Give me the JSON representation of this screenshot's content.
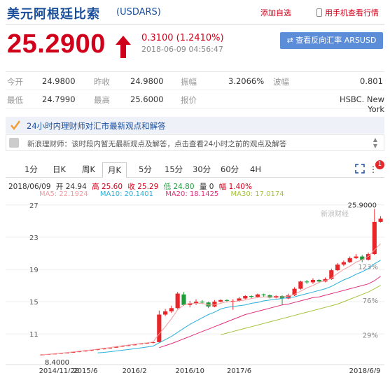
{
  "header": {
    "title": "美元阿根廷比索",
    "code": "(USDARS)",
    "add_favorite": "添加自选",
    "phone_view": "用手机查看行情"
  },
  "quote": {
    "price": "25.2900",
    "change": "0.3100 (1.2410%)",
    "timestamp": "2018-06-09 04:56:47",
    "reverse_button": "查看反向汇率 ARSUSD"
  },
  "stats": {
    "open_label": "今开",
    "open": "24.9800",
    "prev_close_label": "昨收",
    "prev_close": "24.9800",
    "amplitude_label": "振幅",
    "amplitude": "3.2066%",
    "volatility_label": "波幅",
    "volatility": "0.801",
    "low_label": "最低",
    "low": "24.7990",
    "high_label": "最高",
    "high": "25.6000",
    "quote_label": "报价",
    "quote_source": "HSBC. New York"
  },
  "expert": {
    "title": "24小时内理财师对汇市最新观点和解答",
    "message": "新浪理财师：该时段内暂无最新观点及解答，点击查看24小时之前的观点及解答"
  },
  "tabs": [
    "1分",
    "日K",
    "周K",
    "月K",
    "5分",
    "15分",
    "30分",
    "60分",
    "4H"
  ],
  "active_tab": "月K",
  "badge_count": "1",
  "ohlc": {
    "date": "2018/06/09",
    "open": "开 24.94",
    "high": "高 25.60",
    "close": "收 25.29",
    "low": "低 24.80",
    "volume": "量 0",
    "range": "幅 1.40%"
  },
  "ma": {
    "ma5": "MA5: 22.1924",
    "ma10": "MA10: 20.1401",
    "ma20": "MA20: 18.1425",
    "ma30": "MA30: 17.0174"
  },
  "colors": {
    "up": "#e8262a",
    "down": "#1e9b3a",
    "ma5": "#f29c9f",
    "ma10": "#2ab0d8",
    "ma20": "#e0307a",
    "ma30": "#a5c23a"
  },
  "chart_data": {
    "type": "candlestick",
    "yticks": [
      "27",
      "23",
      "19",
      "15",
      "11"
    ],
    "ylim": [
      7.2,
      27.5
    ],
    "pct_labels": [
      "123%",
      "76%",
      "29%"
    ],
    "xticks": [
      "2014/11/28",
      "2015/6",
      "2016/2",
      "2016/10",
      "2017/6",
      "2018/6/9"
    ],
    "min_label": "8.4000",
    "max_label": "25.9000",
    "watermark": "新浪财经",
    "candles": [
      [
        8.4,
        8.45,
        8.38,
        8.48
      ],
      [
        8.45,
        8.5,
        8.42,
        8.53
      ],
      [
        8.5,
        8.56,
        8.48,
        8.6
      ],
      [
        8.56,
        8.62,
        8.54,
        8.66
      ],
      [
        8.62,
        8.68,
        8.6,
        8.72
      ],
      [
        8.68,
        8.76,
        8.66,
        8.8
      ],
      [
        8.76,
        8.84,
        8.74,
        8.88
      ],
      [
        8.84,
        8.92,
        8.82,
        8.96
      ],
      [
        8.92,
        9.01,
        8.9,
        9.05
      ],
      [
        9.01,
        9.1,
        8.99,
        9.14
      ],
      [
        9.1,
        9.2,
        9.08,
        9.24
      ],
      [
        9.2,
        9.3,
        9.18,
        9.34
      ],
      [
        9.3,
        9.42,
        9.28,
        9.46
      ],
      [
        9.42,
        9.52,
        9.4,
        9.56
      ],
      [
        9.52,
        9.6,
        9.5,
        9.64
      ],
      [
        9.6,
        9.72,
        9.58,
        9.76
      ],
      [
        9.72,
        9.8,
        9.7,
        9.84
      ],
      [
        9.8,
        9.88,
        9.78,
        9.92
      ],
      [
        9.88,
        9.98,
        9.85,
        10.05
      ],
      [
        9.98,
        13.4,
        9.95,
        13.9
      ],
      [
        13.4,
        13.8,
        13.2,
        14.1
      ],
      [
        13.8,
        14.2,
        13.6,
        14.5
      ],
      [
        14.2,
        16.0,
        14.1,
        16.2
      ],
      [
        15.9,
        14.6,
        14.5,
        16.2
      ],
      [
        14.6,
        14.8,
        14.3,
        15.1
      ],
      [
        14.8,
        15.0,
        14.6,
        15.3
      ],
      [
        15.0,
        14.9,
        14.7,
        15.2
      ],
      [
        14.9,
        14.4,
        14.2,
        15.0
      ],
      [
        14.4,
        15.0,
        14.3,
        15.2
      ],
      [
        15.0,
        15.2,
        14.9,
        15.3
      ],
      [
        15.2,
        15.1,
        14.9,
        15.3
      ],
      [
        15.1,
        15.1,
        14.0,
        15.3
      ],
      [
        15.1,
        15.4,
        15.0,
        15.6
      ],
      [
        15.4,
        15.7,
        15.3,
        15.8
      ],
      [
        15.7,
        15.6,
        15.4,
        15.8
      ],
      [
        15.6,
        15.9,
        15.5,
        16.0
      ],
      [
        15.9,
        15.8,
        15.6,
        16.0
      ],
      [
        15.8,
        15.5,
        15.4,
        15.9
      ],
      [
        15.5,
        15.7,
        15.4,
        15.8
      ],
      [
        15.7,
        15.4,
        14.6,
        15.8
      ],
      [
        15.4,
        15.8,
        15.3,
        16.0
      ],
      [
        15.8,
        16.6,
        15.7,
        16.8
      ],
      [
        16.6,
        17.5,
        16.5,
        17.6
      ],
      [
        17.5,
        17.4,
        17.2,
        17.7
      ],
      [
        17.4,
        17.7,
        17.2,
        17.9
      ],
      [
        17.7,
        17.5,
        17.3,
        17.8
      ],
      [
        17.5,
        17.8,
        17.4,
        18.0
      ],
      [
        17.8,
        18.9,
        17.7,
        19.1
      ],
      [
        18.9,
        19.6,
        18.8,
        19.8
      ],
      [
        19.6,
        19.9,
        19.4,
        20.1
      ],
      [
        19.9,
        20.4,
        19.8,
        20.6
      ],
      [
        20.4,
        20.6,
        20.3,
        20.9
      ],
      [
        20.6,
        20.2,
        19.9,
        20.8
      ],
      [
        20.2,
        20.9,
        20.1,
        21.1
      ],
      [
        20.9,
        24.9,
        20.8,
        26.5
      ],
      [
        24.9,
        25.29,
        24.8,
        25.6
      ]
    ],
    "ma": {
      "ma5": [
        8.42,
        8.48,
        8.55,
        8.62,
        8.7,
        8.78,
        8.86,
        8.94,
        9.03,
        9.12,
        9.22,
        9.32,
        9.43,
        9.53,
        9.63,
        9.72,
        9.81,
        9.9,
        10.0,
        11.0,
        11.9,
        12.9,
        14.0,
        14.6,
        14.8,
        14.8,
        14.8,
        14.6,
        14.6,
        14.8,
        15.0,
        15.0,
        15.1,
        15.2,
        15.4,
        15.5,
        15.6,
        15.6,
        15.6,
        15.6,
        15.7,
        15.9,
        16.3,
        16.7,
        17.0,
        17.4,
        17.6,
        17.9,
        18.5,
        19.0,
        19.4,
        19.9,
        20.2,
        20.6,
        21.4,
        22.19
      ],
      "ma10": [
        null,
        null,
        null,
        null,
        null,
        null,
        null,
        null,
        null,
        8.65,
        8.72,
        8.8,
        8.89,
        8.98,
        9.07,
        9.17,
        9.27,
        9.38,
        9.49,
        9.9,
        10.3,
        10.7,
        11.2,
        11.7,
        12.2,
        12.6,
        13.0,
        13.4,
        13.7,
        14.1,
        14.3,
        14.4,
        14.5,
        14.6,
        14.8,
        14.9,
        15.1,
        15.2,
        15.3,
        15.4,
        15.5,
        15.6,
        15.8,
        16.0,
        16.2,
        16.4,
        16.6,
        16.9,
        17.3,
        17.7,
        18.0,
        18.4,
        18.7,
        19.1,
        19.7,
        20.14
      ],
      "ma20": [
        null,
        null,
        null,
        null,
        null,
        null,
        null,
        null,
        null,
        null,
        null,
        null,
        null,
        null,
        null,
        null,
        null,
        null,
        null,
        9.3,
        9.55,
        9.8,
        10.1,
        10.4,
        10.7,
        11.0,
        11.3,
        11.6,
        11.9,
        12.2,
        12.5,
        12.8,
        13.1,
        13.4,
        13.6,
        13.8,
        14.0,
        14.2,
        14.4,
        14.6,
        14.7,
        14.9,
        15.1,
        15.3,
        15.5,
        15.6,
        15.8,
        16.0,
        16.2,
        16.4,
        16.6,
        16.8,
        17.0,
        17.2,
        17.6,
        18.14
      ],
      "ma30": [
        null,
        null,
        null,
        null,
        null,
        null,
        null,
        null,
        null,
        null,
        null,
        null,
        null,
        null,
        null,
        null,
        null,
        null,
        null,
        null,
        null,
        null,
        null,
        null,
        null,
        null,
        null,
        null,
        null,
        10.9,
        11.1,
        11.3,
        11.5,
        11.7,
        11.9,
        12.1,
        12.3,
        12.5,
        12.7,
        12.9,
        13.1,
        13.3,
        13.5,
        13.7,
        13.9,
        14.1,
        14.3,
        14.5,
        14.7,
        15.0,
        15.3,
        15.6,
        15.9,
        16.2,
        16.6,
        17.02
      ]
    }
  }
}
